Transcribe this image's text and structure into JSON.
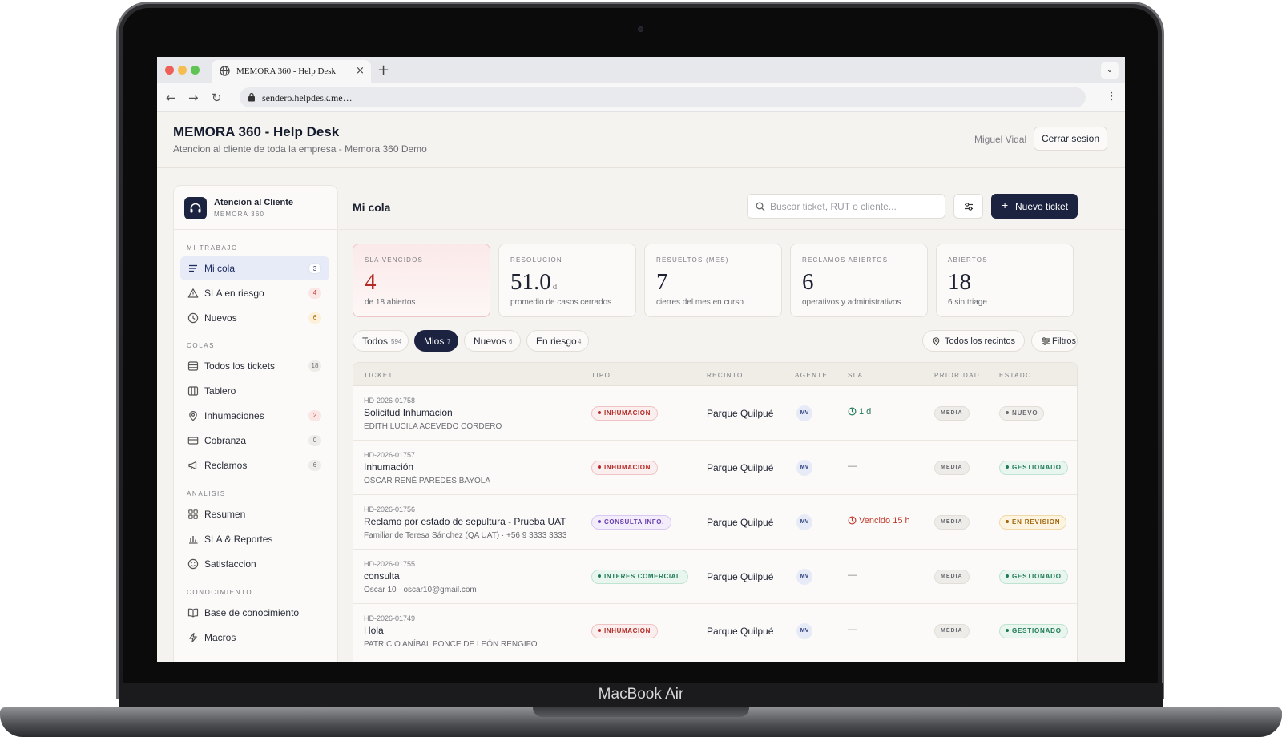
{
  "device": {
    "label": "MacBook Air"
  },
  "browser": {
    "tab_title": "MEMORA 360 - Help Desk",
    "url": "sendero.helpdesk.me…"
  },
  "header": {
    "title": "MEMORA 360 - Help Desk",
    "subtitle": "Atencion al cliente de toda la empresa - Memora 360 Demo",
    "user": "Miguel Vidal",
    "logout": "Cerrar sesion"
  },
  "sidebar": {
    "brand_name": "Atencion al Cliente",
    "brand_sub": "MEMORA 360",
    "sections": {
      "work": "MI TRABAJO",
      "queues": "COLAS",
      "analysis": "ANALISIS",
      "knowledge": "CONOCIMIENTO"
    },
    "items": [
      {
        "label": "Mi cola",
        "count": "3"
      },
      {
        "label": "SLA en riesgo",
        "count": "4"
      },
      {
        "label": "Nuevos",
        "count": "6"
      },
      {
        "label": "Todos los tickets",
        "count": "18"
      },
      {
        "label": "Tablero",
        "count": ""
      },
      {
        "label": "Inhumaciones",
        "count": "2"
      },
      {
        "label": "Cobranza",
        "count": "0"
      },
      {
        "label": "Reclamos",
        "count": "6"
      },
      {
        "label": "Resumen",
        "count": ""
      },
      {
        "label": "SLA & Reportes",
        "count": ""
      },
      {
        "label": "Satisfaccion",
        "count": ""
      },
      {
        "label": "Base de conocimiento",
        "count": ""
      },
      {
        "label": "Macros",
        "count": ""
      }
    ]
  },
  "main": {
    "title": "Mi cola",
    "search_placeholder": "Buscar ticket, RUT o cliente...",
    "new_ticket": "Nuevo ticket"
  },
  "stats": [
    {
      "label": "SLA VENCIDOS",
      "value": "4",
      "unit": "",
      "desc": "de 18 abiertos"
    },
    {
      "label": "RESOLUCION",
      "value": "51.0",
      "unit": "d",
      "desc": "promedio de casos cerrados"
    },
    {
      "label": "RESUELTOS (MES)",
      "value": "7",
      "unit": "",
      "desc": "cierres del mes en curso"
    },
    {
      "label": "RECLAMOS ABIERTOS",
      "value": "6",
      "unit": "",
      "desc": "operativos y administrativos"
    },
    {
      "label": "ABIERTOS",
      "value": "18",
      "unit": "",
      "desc": "6 sin triage"
    }
  ],
  "filters": {
    "chips": [
      {
        "label": "Todos",
        "count": "594"
      },
      {
        "label": "Mios",
        "count": "7"
      },
      {
        "label": "Nuevos",
        "count": "6"
      },
      {
        "label": "En riesgo",
        "count": "4"
      }
    ],
    "recintos": "Todos los recintos",
    "filtros": "Filtros"
  },
  "table": {
    "columns": [
      "TICKET",
      "TIPO",
      "RECINTO",
      "AGENTE",
      "SLA",
      "PRIORIDAD",
      "ESTADO"
    ],
    "rows": [
      {
        "id": "HD-2026-01758",
        "title": "Solicitud Inhumacion",
        "sub": "EDITH LUCILA ACEVEDO CORDERO",
        "tipo": "INHUMACION",
        "recinto": "Parque Quilpué",
        "agente": "MV",
        "sla": "1 d",
        "prioridad": "MEDIA",
        "estado": "NUEVO"
      },
      {
        "id": "HD-2026-01757",
        "title": "Inhumación",
        "sub": "OSCAR RENÉ PAREDES BAYOLA",
        "tipo": "INHUMACION",
        "recinto": "Parque Quilpué",
        "agente": "MV",
        "sla": "—",
        "prioridad": "MEDIA",
        "estado": "GESTIONADO"
      },
      {
        "id": "HD-2026-01756",
        "title": "Reclamo por estado de sepultura - Prueba UAT",
        "sub": "Familiar de Teresa Sánchez (QA UAT) · +56 9 3333 3333",
        "tipo": "CONSULTA INFO.",
        "recinto": "Parque Quilpué",
        "agente": "MV",
        "sla": "Vencido 15 h",
        "prioridad": "MEDIA",
        "estado": "EN REVISION"
      },
      {
        "id": "HD-2026-01755",
        "title": "consulta",
        "sub": "Oscar 10 · oscar10@gmail.com",
        "tipo": "INTERES COMERCIAL",
        "recinto": "Parque Quilpué",
        "agente": "MV",
        "sla": "—",
        "prioridad": "MEDIA",
        "estado": "GESTIONADO"
      },
      {
        "id": "HD-2026-01749",
        "title": "Hola",
        "sub": "PATRICIO ANÍBAL PONCE DE LEÓN RENGIFO",
        "tipo": "INHUMACION",
        "recinto": "Parque Quilpué",
        "agente": "MV",
        "sla": "—",
        "prioridad": "MEDIA",
        "estado": "GESTIONADO"
      }
    ]
  }
}
